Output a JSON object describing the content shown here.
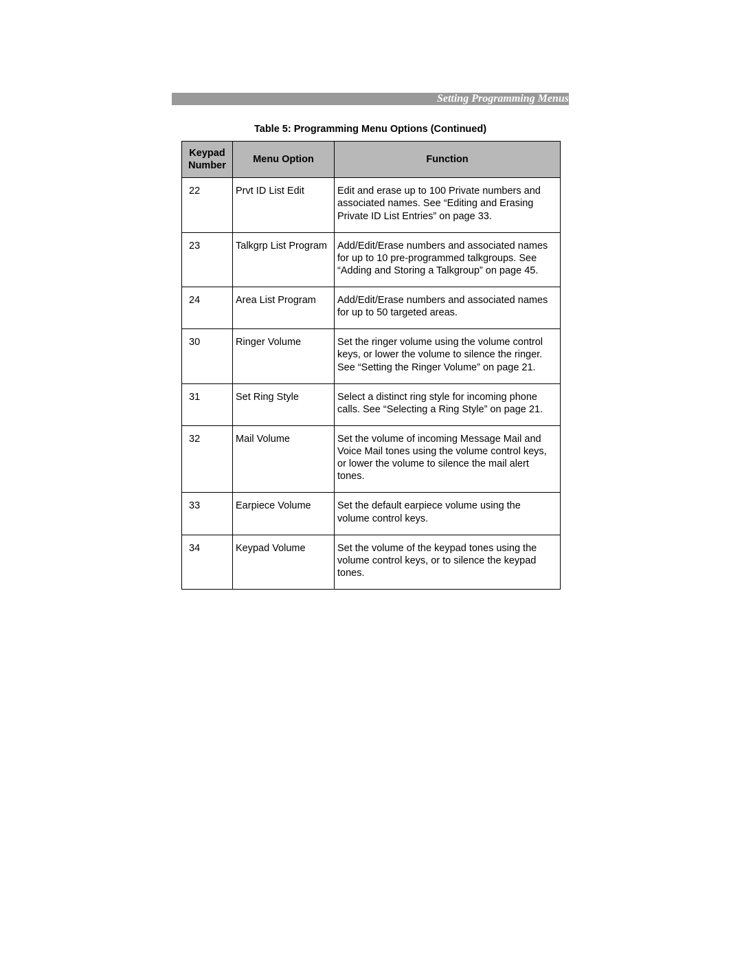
{
  "header": {
    "title": "Setting Programming Menus"
  },
  "caption": "Table 5: Programming Menu Options  (Continued)",
  "columns": {
    "keypad": "Keypad Number",
    "menu": "Menu Option",
    "func": "Function"
  },
  "rows": [
    {
      "keypad": "22",
      "menu": "Prvt ID List Edit",
      "func": "Edit and erase up to 100 Private numbers and associated names. See “Editing and Erasing Private ID List Entries” on page 33."
    },
    {
      "keypad": "23",
      "menu": "Talkgrp List Program",
      "func": "Add/Edit/Erase numbers and associated names for up to 10 pre-programmed talkgroups. See “Adding and Storing a Talkgroup” on page 45."
    },
    {
      "keypad": "24",
      "menu": "Area List Program",
      "func": "Add/Edit/Erase numbers and associated names for up to 50 targeted areas."
    },
    {
      "keypad": "30",
      "menu": "Ringer Volume",
      "func": "Set the ringer volume using the volume control keys, or lower the volume to silence the ringer. See “Setting the Ringer Volume” on page 21."
    },
    {
      "keypad": "31",
      "menu": "Set Ring Style",
      "func": "Select a distinct ring style for incoming phone calls. See “Selecting a Ring Style” on page 21."
    },
    {
      "keypad": "32",
      "menu": "Mail Volume",
      "func": "Set the volume of incoming Message Mail and Voice Mail tones using the volume control keys, or lower the volume to silence the mail alert tones."
    },
    {
      "keypad": "33",
      "menu": "Earpiece Volume",
      "func": "Set the default earpiece volume using the volume control keys."
    },
    {
      "keypad": "34",
      "menu": "Keypad Volume",
      "func": "Set the volume of the keypad tones using the volume control keys, or to silence the keypad tones."
    }
  ]
}
